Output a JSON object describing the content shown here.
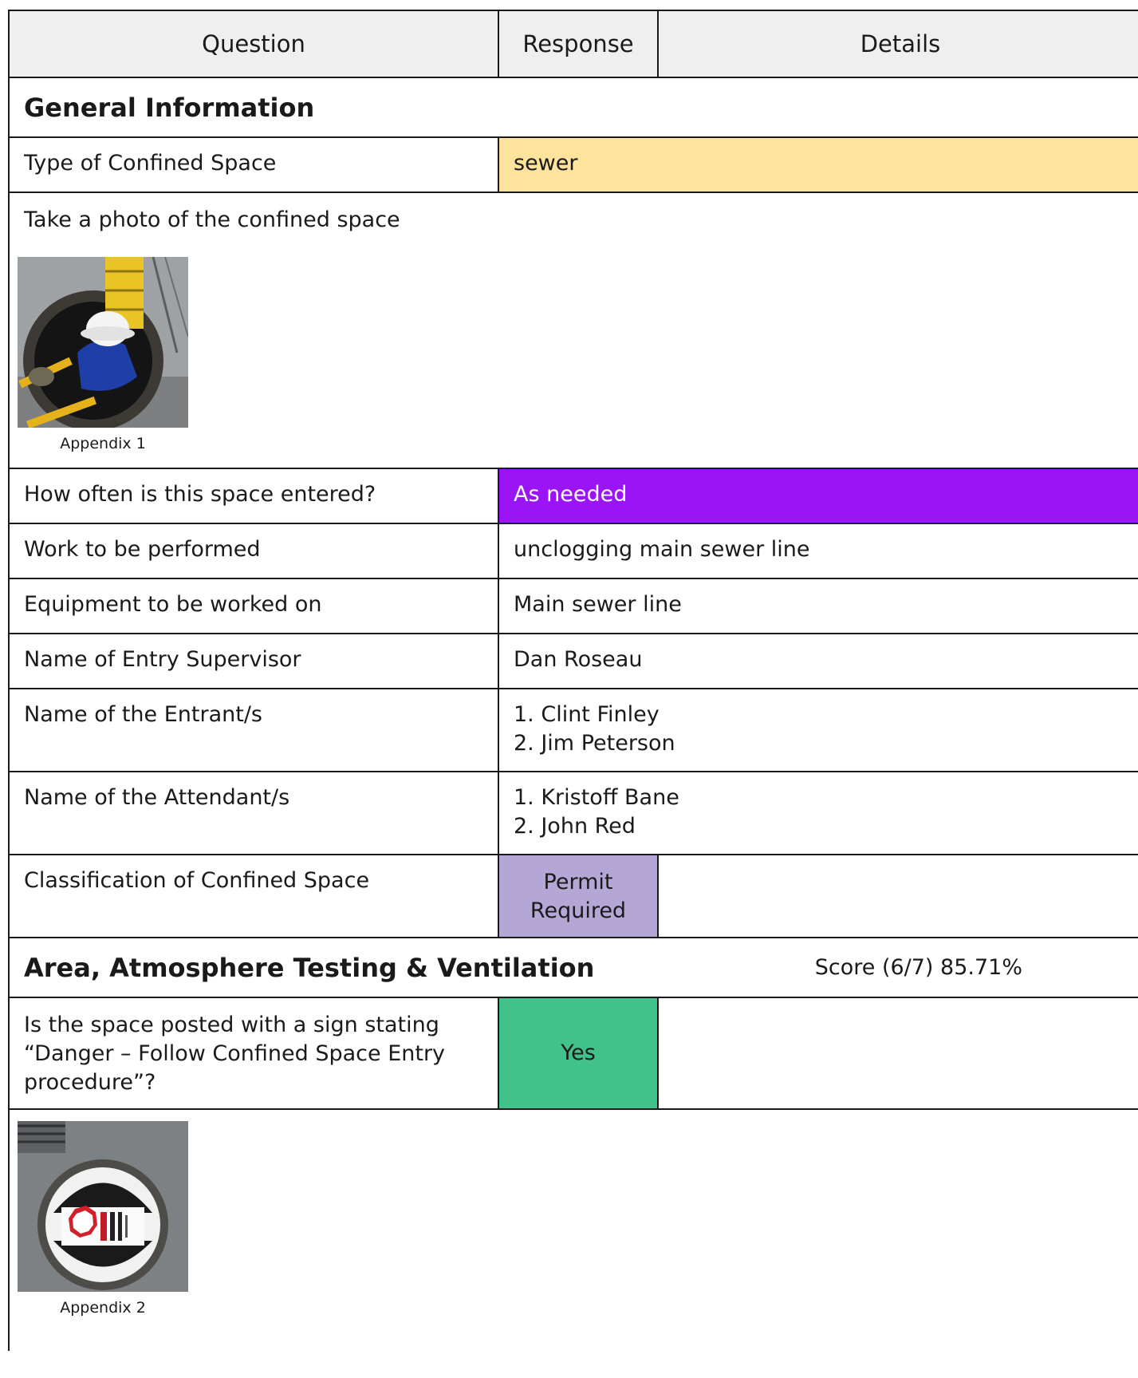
{
  "header": {
    "question": "Question",
    "response": "Response",
    "details": "Details"
  },
  "sections": {
    "general": {
      "title": "General Information"
    },
    "area": {
      "title": "Area, Atmosphere Testing & Ventilation",
      "score": "Score (6/7) 85.71%"
    }
  },
  "rows": {
    "type_space": {
      "question": "Type of Confined Space",
      "response": "sewer",
      "color": "#fde39b"
    },
    "photo": {
      "question": "Take a photo of the confined space",
      "caption": "Appendix 1"
    },
    "often": {
      "question": "How often is this space entered?",
      "response": "As needed",
      "color": "#9b14f5"
    },
    "work": {
      "question": "Work to be performed",
      "response": "unclogging main sewer line"
    },
    "equipment": {
      "question": "Equipment to be worked on",
      "response": "Main sewer line"
    },
    "supervisor": {
      "question": "Name of Entry Supervisor",
      "response": "Dan Roseau"
    },
    "entrants": {
      "question": "Name of the Entrant/s",
      "response": [
        "1. Clint Finley",
        "2. Jim Peterson"
      ]
    },
    "attendants": {
      "question": "Name of the Attendant/s",
      "response": [
        "1. Kristoff Bane",
        "2. John Red"
      ]
    },
    "classification": {
      "question": "Classification of Confined Space",
      "response": [
        "Permit",
        "Required"
      ],
      "color": "#b4a7d6"
    },
    "posted": {
      "question": [
        "Is the space posted with a sign stating",
        "“Danger – Follow Confined Space Entry",
        "procedure”?"
      ],
      "response": "Yes",
      "color": "#41c28a"
    },
    "photo2": {
      "caption": "Appendix 2"
    }
  }
}
